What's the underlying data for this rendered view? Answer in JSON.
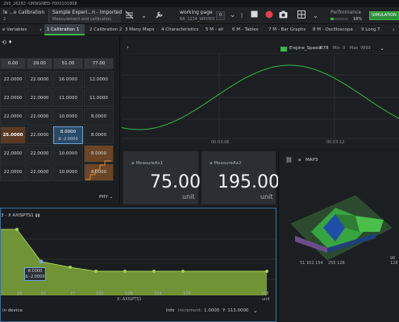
{
  "titlebar": {
    "text": "295_26282 -UNSIGNED-7000101808"
  },
  "toolbar": {
    "doc1_line1": "le ...e Calibration",
    "doc1_line2": "2",
    "doc2_line1": "Sample Experi...n - Imported",
    "doc2_line2": "Measurement and calibration",
    "working_page_label": "working page",
    "working_page_value": "RA_1234_WP.HEX",
    "wp_count": "0",
    "performance_label": "Performance",
    "performance_value": "18%",
    "performance_level": 0.18,
    "simulation_label": "SIMULATION"
  },
  "tabs": {
    "left_label": "e Variables",
    "items": [
      "1 Calibration 1",
      "2 Calibration 2",
      "3 Many Maps",
      "4 Characteristics",
      "5 M - all",
      "6 M - Tables",
      "7 M - Bar Graphs",
      "8 M - Oscilloscope",
      "9 Long T"
    ]
  },
  "table": {
    "headers": [
      "0.00",
      "29.00",
      "51.00",
      "77.00"
    ],
    "rows": [
      [
        "22.0000",
        "22.0000",
        "16.0000",
        "12.0000"
      ],
      [
        "22.0000",
        "22.0000",
        "11.0000",
        "11.0000"
      ],
      [
        "22.0000",
        "22.0000",
        "10.0000",
        "8.0000"
      ],
      [
        "25.0000",
        "22.0000",
        "8.0000",
        "8.0000"
      ],
      [
        "22.0000",
        "22.0000",
        "10.0000",
        "8.0000"
      ],
      [
        "22.0000",
        "22.0000",
        "10.0000",
        "8.0000"
      ]
    ],
    "selected_delta": "Δ -2.0000",
    "phy_label": "PHY"
  },
  "scope": {
    "signal_name": "Engine_Speed",
    "signal_value": "678",
    "min_label": "Min",
    "min_value": "0",
    "max_label": "Max",
    "max_value": "9999",
    "time1": "00:03:06",
    "time2": "00:03:12"
  },
  "gauges": [
    {
      "title": "MeasureAx1",
      "value": "75.00",
      "unit": "unit"
    },
    {
      "title": "MeasureAx2",
      "value": "195.00",
      "unit": "unit"
    }
  ],
  "map3d": {
    "title": "MAP3",
    "axis_labels": [
      "51",
      "102",
      "154",
      "255",
      "128",
      "96",
      "128"
    ]
  },
  "curve": {
    "title": "3 - X AXISPTS1",
    "tooltip_value": "8.0000",
    "tooltip_delta": "Δ -2.0000",
    "x_ticks": [
      "29",
      "51",
      "77",
      "102",
      "128",
      "154",
      "179",
      "255"
    ],
    "x_axis_label": "X: AXISPTS1",
    "unit_label": "unit",
    "status_left": "in device",
    "info_label": "Info",
    "increment_label": "Increment:",
    "increment_value": "1.0000",
    "y_label": "Y: 113.0000"
  },
  "colors": {
    "accent": "#39b54a",
    "selection": "#6fa6d6",
    "curve_fill": "#7fa83a"
  }
}
